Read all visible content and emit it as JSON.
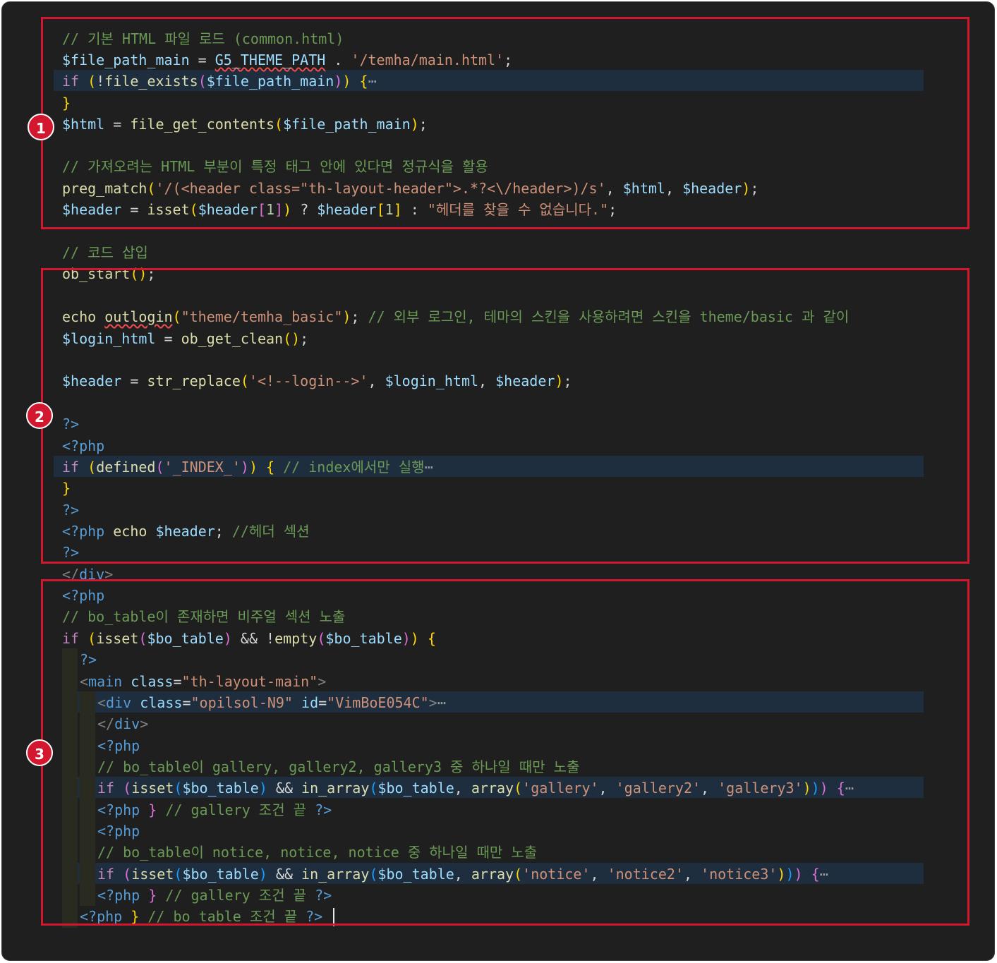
{
  "annotations": [
    "1",
    "2",
    "3"
  ],
  "editor": {
    "lines": [
      "// 기본 HTML 파일 로드 (common.html)",
      "$file_path_main = G5_THEME_PATH . '/temha/main.html';",
      "if (!file_exists($file_path_main)) {⋯",
      "}",
      "$html = file_get_contents($file_path_main);",
      "// 가져오려는 HTML 부분이 특정 태그 안에 있다면 정규식을 활용",
      "preg_match('/(<header class=\"th-layout-header\">.*?<\\/header>)/s', $html, $header);",
      "$header = isset($header[1]) ? $header[1] : \"헤더를 찾을 수 없습니다.\";",
      "// 코드 삽입",
      "ob_start();",
      "echo outlogin(\"theme/temha_basic\"); // 외부 로그인, 테마의 스킨을 사용하려면 스킨을 theme/basic 과 같이",
      "$login_html = ob_get_clean();",
      "$header = str_replace('<!--login-->', $login_html, $header);",
      "?>",
      "<?php",
      "if (defined('_INDEX_')) { // index에서만 실행⋯",
      "}",
      "?>",
      "<?php echo $header; //헤더 섹션",
      "?>",
      "</div>",
      "<?php",
      "// bo_table이 존재하면 비주얼 섹션 노출",
      "if (isset($bo_table) && !empty($bo_table)) {",
      "?>",
      "<main class=\"th-layout-main\">",
      "<div class=\"opilsol-N9\" id=\"VimBoE054C\">⋯",
      "</div>",
      "<?php",
      "// bo_table이 gallery, gallery2, gallery3 중 하나일 때만 노출",
      "if (isset($bo_table) && in_array($bo_table, array('gallery', 'gallery2', 'gallery3'))) {⋯",
      "<?php } // gallery 조건 끝 ?>",
      "<?php",
      "// bo_table이 notice, notice, notice 중 하나일 때만 노출",
      "if (isset($bo_table) && in_array($bo_table, array('notice', 'notice2', 'notice3'))) {⋯",
      "<?php } // gallery 조건 끝 ?>",
      "<?php } // bo_table 조건 끝 ?>"
    ]
  },
  "colors": {
    "annotation": "#d3172e",
    "background": "#1f1f1f",
    "comment": "#6a9955",
    "variable": "#9cdcfe",
    "function": "#dcdcaa",
    "string": "#ce9178"
  }
}
